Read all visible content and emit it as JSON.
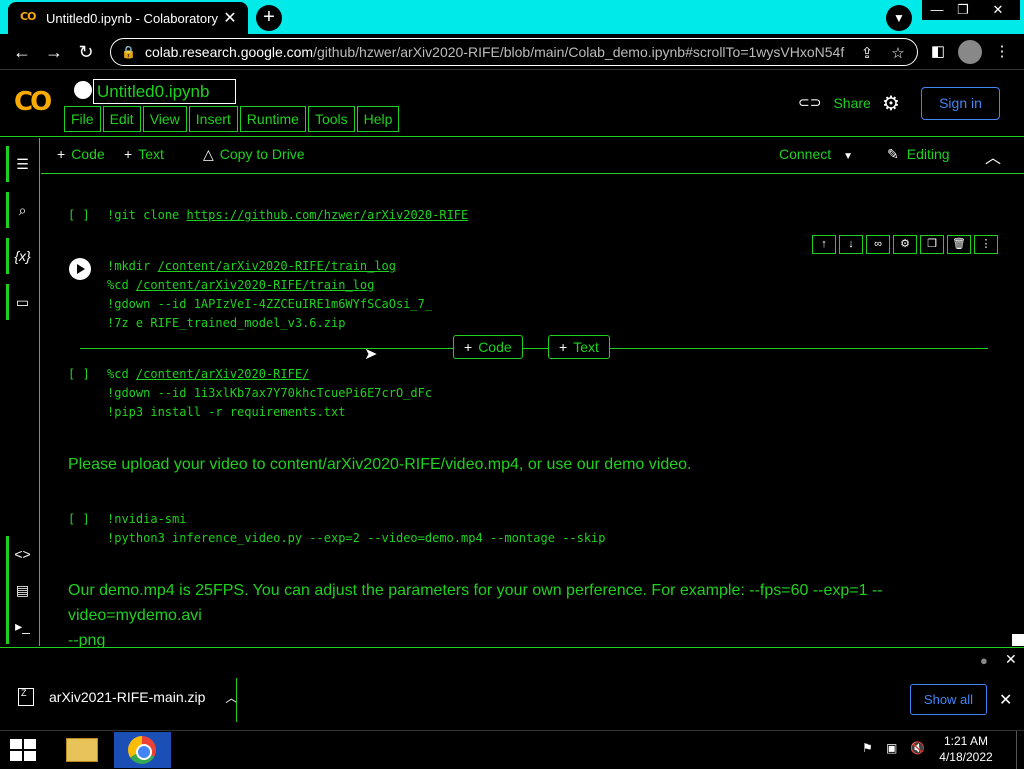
{
  "browser": {
    "tab_title": "Untitled0.ipynb - Colaboratory",
    "tab_logo_text": "CO",
    "new_tab": "+",
    "tab_close": "✕",
    "url_host": "colab.research.google.com",
    "url_path": "/github/hzwer/arXiv2020-RIFE/blob/main/Colab_demo.ipynb#scrollTo=1wysVHxoN54f"
  },
  "colab": {
    "logo_text": "CO",
    "notebook_title": "Untitled0.ipynb",
    "menu": [
      "File",
      "Edit",
      "View",
      "Insert",
      "Runtime",
      "Tools",
      "Help"
    ],
    "share_label": "Share",
    "signin_label": "Sign in"
  },
  "toolbar": {
    "add_code": "Code",
    "add_text": "Text",
    "copy_to_drive": "Copy to Drive",
    "connect": "Connect",
    "editing": "Editing"
  },
  "cells": {
    "c1_bracket": "[ ]",
    "c1_prefix": "!git clone ",
    "c1_link": "https://github.com/hzwer/arXiv2020-RIFE",
    "c2_l1_prefix": "!mkdir ",
    "c2_l1_link": "/content/arXiv2020-RIFE/train_log",
    "c2_l2_prefix": "%cd ",
    "c2_l2_link": "/content/arXiv2020-RIFE/train_log",
    "c2_l3": "!gdown --id 1APIzVeI-4ZZCEuIRE1m6WYfSCaOsi_7_",
    "c2_l4": "!7z e RIFE_trained_model_v3.6.zip",
    "insert_code": "Code",
    "insert_text": "Text",
    "c3_bracket": "[ ]",
    "c3_l1_prefix": "%cd ",
    "c3_l1_link": "/content/arXiv2020-RIFE/",
    "c3_l2": "!gdown --id 1i3xlKb7ax7Y70khcTcuePi6E7crO_dFc",
    "c3_l3": "!pip3 install -r requirements.txt",
    "md1": "Please upload your video to content/arXiv2020-RIFE/video.mp4, or use our demo video.",
    "c4_bracket": "[ ]",
    "c4_l1": "!nvidia-smi",
    "c4_l2": "!python3 inference_video.py --exp=2 --video=demo.mp4 --montage --skip",
    "md2_l1": "Our demo.mp4 is 25FPS. You can adjust the parameters for your own perference. For example: --fps=60 --exp=1 --video=mydemo.avi",
    "md2_l2": "--png"
  },
  "downloads": {
    "file_name": "arXiv2021-RIFE-main.zip",
    "show_all": "Show all"
  },
  "taskbar": {
    "time": "1:21 AM",
    "date": "4/18/2022"
  },
  "colors": {
    "accent_green": "#1fd11f",
    "tab_strip": "#00eaea",
    "link_blue": "#4285f4",
    "colab_orange": "#f9ab00"
  }
}
